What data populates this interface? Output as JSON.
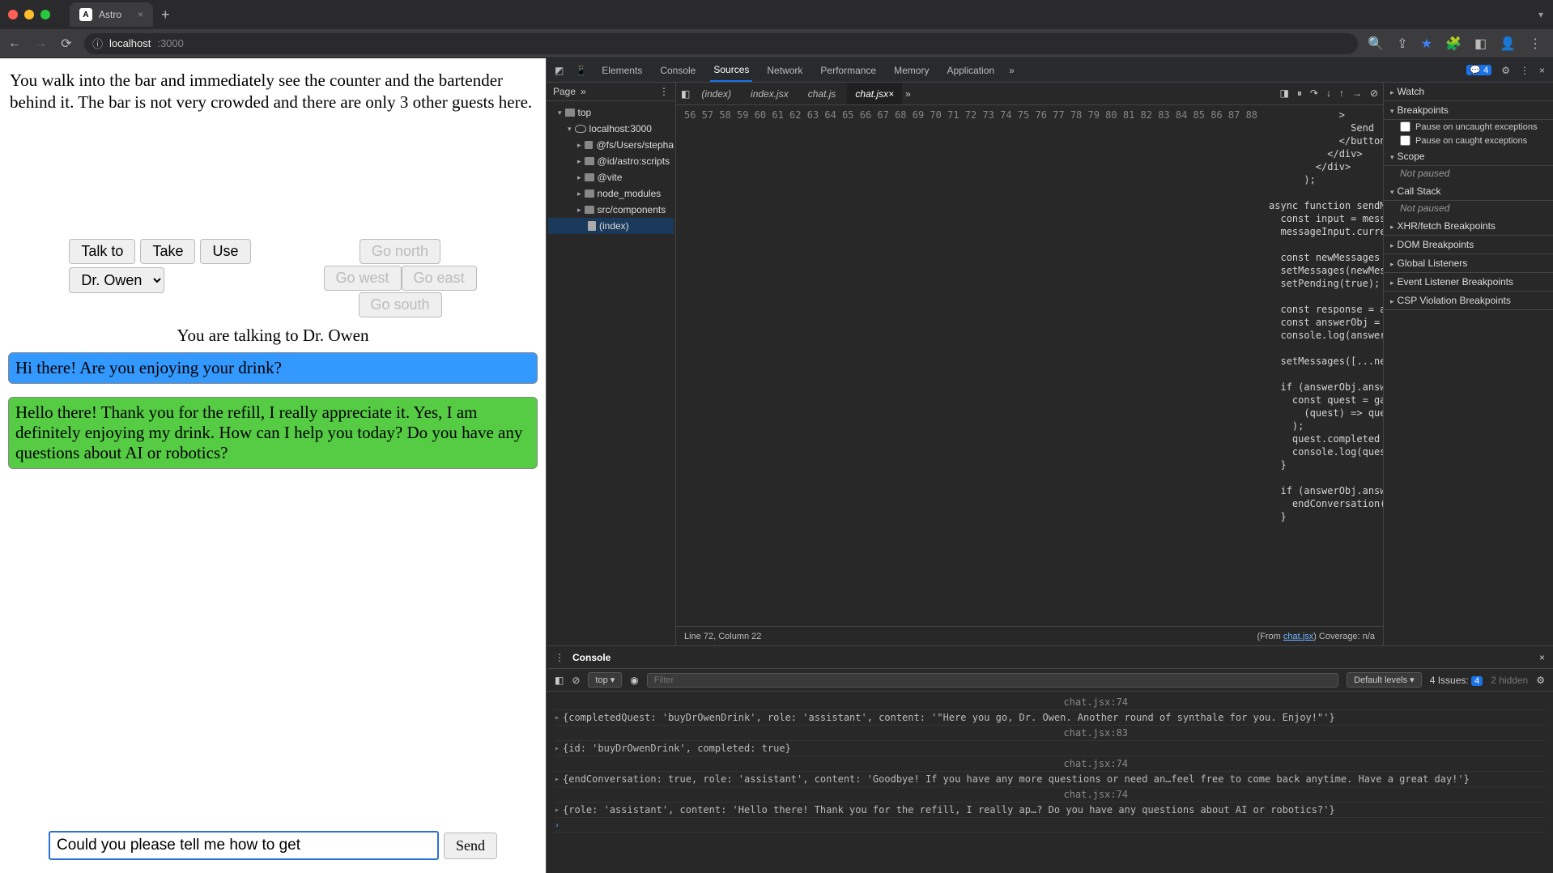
{
  "browser": {
    "tab_title": "Astro",
    "url_host": "localhost",
    "url_port": ":3000"
  },
  "game": {
    "intro": "You walk into the bar and immediately see the counter and the bartender behind it. The bar is not very crowded and there are only 3 other guests here.",
    "talk_to": "Talk to",
    "take": "Take",
    "use": "Use",
    "go_north": "Go north",
    "go_west": "Go west",
    "go_east": "Go east",
    "go_south": "Go south",
    "character": "Dr. Owen",
    "talking_to": "You are talking to Dr. Owen",
    "user_msg": "Hi there! Are you enjoying your drink?",
    "bot_msg": "Hello there! Thank you for the refill, I really appreciate it. Yes, I am definitely enjoying my drink. How can I help you today? Do you have any questions about AI or robotics?",
    "input_value": "Could you please tell me how to get ",
    "send": "Send"
  },
  "devtools": {
    "tabs": {
      "elements": "Elements",
      "console": "Console",
      "sources": "Sources",
      "network": "Network",
      "performance": "Performance",
      "memory": "Memory",
      "application": "Application"
    },
    "more": "»",
    "issues_count": "4",
    "page_label": "Page",
    "file_tabs": {
      "index": "(index)",
      "indexjsx": "index.jsx",
      "chatjs": "chat.js",
      "chatjsx": "chat.jsx"
    },
    "tree": {
      "top": "top",
      "host": "localhost:3000",
      "fs": "@fs/Users/stepha",
      "astro": "@id/astro:scripts",
      "vite": "@vite",
      "node": "node_modules",
      "src": "src/components",
      "indexf": "(index)"
    },
    "status": {
      "line": "Line 72, Column 22",
      "from": "(From ",
      "fromlink": "chat.jsx",
      "fromend": ") Coverage: n/a"
    },
    "right": {
      "watch": "Watch",
      "breakpoints": "Breakpoints",
      "pause_uncaught": "Pause on uncaught exceptions",
      "pause_caught": "Pause on caught exceptions",
      "scope": "Scope",
      "not_paused": "Not paused",
      "callstack": "Call Stack",
      "xhr": "XHR/fetch Breakpoints",
      "dom": "DOM Breakpoints",
      "listeners": "Global Listeners",
      "evt": "Event Listener Breakpoints",
      "csp": "CSP Violation Breakpoints"
    },
    "gutter": [
      "56",
      "57",
      "58",
      "59",
      "60",
      "61",
      "62",
      "63",
      "64",
      "65",
      "66",
      "67",
      "68",
      "69",
      "70",
      "71",
      "72",
      "73",
      "74",
      "75",
      "76",
      "77",
      "78",
      "79",
      "80",
      "81",
      "82",
      "83",
      "84",
      "85",
      "86",
      "87",
      "88"
    ],
    "code_lines": [
      "            >",
      "              Send",
      "            </button>",
      "          </div>",
      "        </div>",
      "      );",
      "",
      "async function sendMessage() {",
      "  const input = messageInput.current.value;",
      "  messageInput.current.value = \"\";",
      "",
      "  const newMessages = [...messages, input];",
      "  setMessages(newMessages);",
      "  setPending(true);",
      "",
      "  const response = await fetch(`/api/chat?msg=${in",
      "  const answerObj = await response.json();",
      "  console.log(answerObj.answer);",
      "",
      "  setMessages([...newMessages, answerObj.answer.co",
      "",
      "  if (answerObj.answer.completedQuest !== undefine",
      "    const quest = gameRuntimeData.quests.find(",
      "      (quest) => quest.id === answerObj.answer.com",
      "    );",
      "    quest.completed = true;",
      "    console.log(quest);",
      "  }",
      "",
      "  if (answerObj.answer.endConversation) {",
      "    endConversation();",
      "  }"
    ],
    "console_sources": {
      "c74": "chat.jsx:74",
      "c83": "chat.jsx:83",
      "c74b": "chat.jsx:74",
      "c74c": "chat.jsx:74"
    },
    "console": {
      "label": "Console",
      "context": "top",
      "filter_ph": "Filter",
      "default_levels": "Default levels",
      "issues": "4 Issues:",
      "issues_n": "4",
      "hidden": "2 hidden",
      "log1": "{completedQuest: 'buyDrOwenDrink', role: 'assistant', content: '\"Here you go, Dr. Owen. Another round of synthale for you. Enjoy!\"'}",
      "log2": "{id: 'buyDrOwenDrink', completed: true}",
      "log3": "{endConversation: true, role: 'assistant', content: 'Goodbye! If you have any more questions or need an…feel free to come back anytime. Have a great day!'}",
      "log4": "{role: 'assistant', content: 'Hello there! Thank you for the refill, I really ap…? Do you have any questions about AI or robotics?'}"
    }
  }
}
